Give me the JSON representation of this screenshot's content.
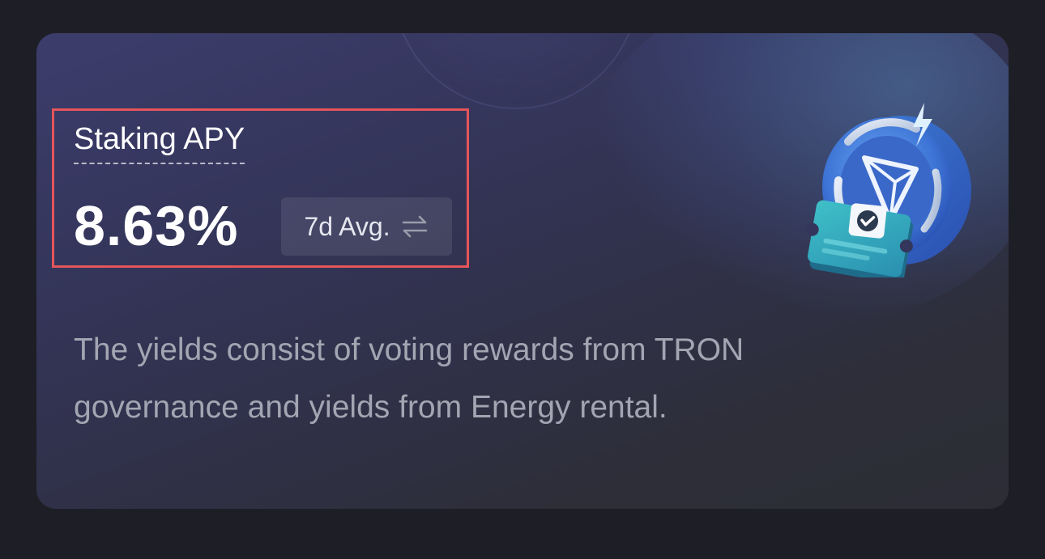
{
  "staking": {
    "label": "Staking APY",
    "value": "8.63%",
    "period_label": "7d Avg.",
    "description": "The yields consist of voting rewards from TRON governance and yields from Energy rental."
  },
  "icons": {
    "period_toggle": "swap-arrows-icon",
    "illustration": "tron-staking-coin-illustration"
  },
  "colors": {
    "highlight_border": "#e5555a",
    "card_gradient_start": "#3c3d6c",
    "card_gradient_end": "#2c2d35",
    "description_text": "#a3a5b2"
  }
}
